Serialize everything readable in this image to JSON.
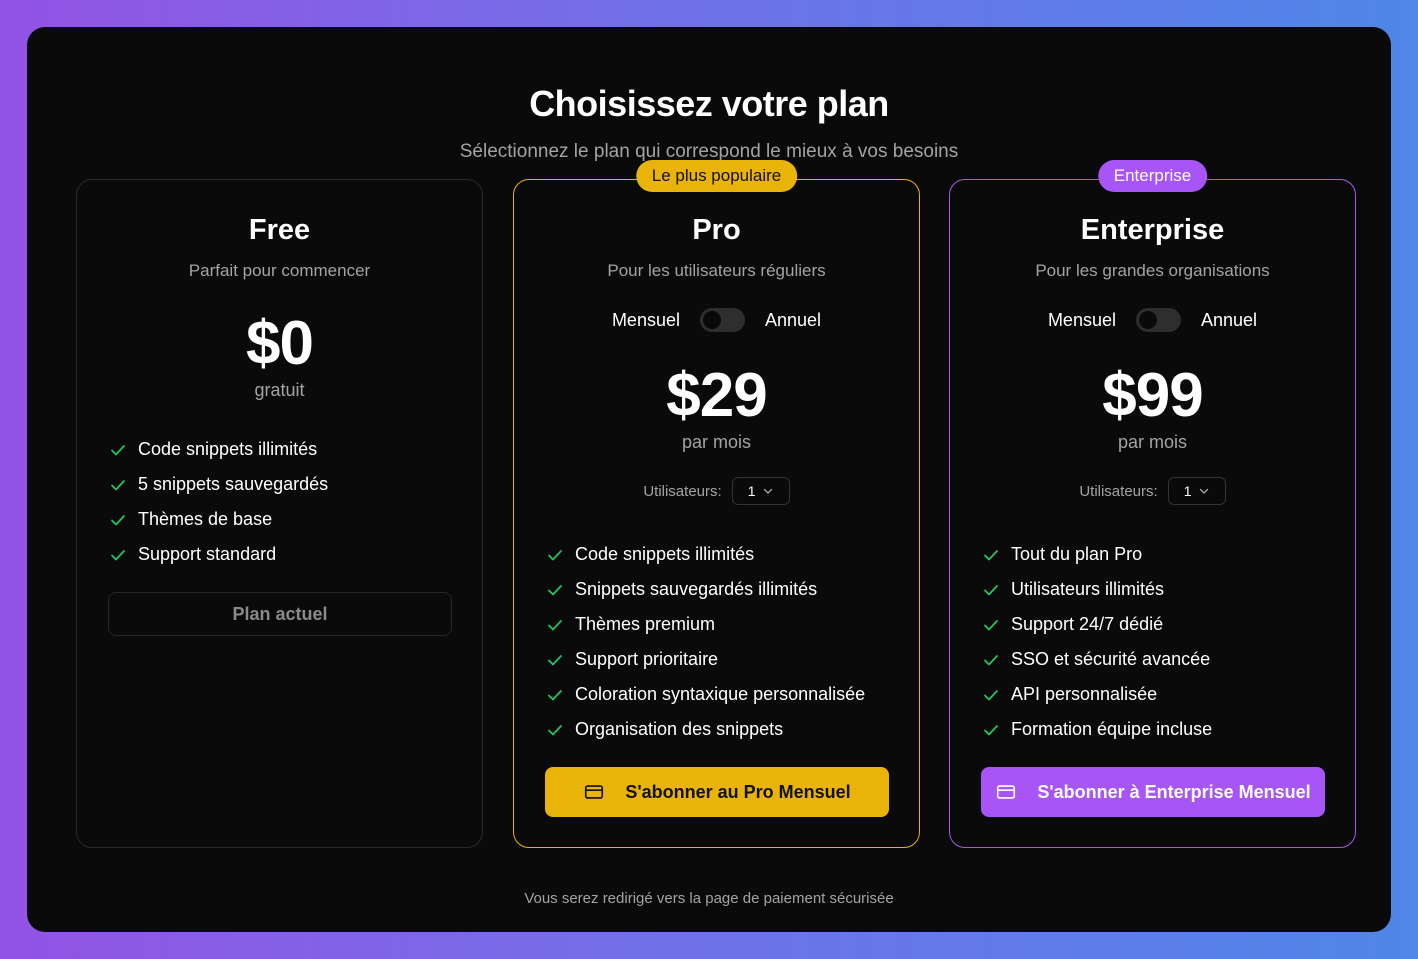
{
  "header": {
    "title": "Choisissez votre plan",
    "subtitle": "Sélectionnez le plan qui correspond le mieux à vos besoins"
  },
  "colors": {
    "accent_pro": "#eab308",
    "accent_enterprise": "#a855f7",
    "check": "#22c55e",
    "panel_bg": "#0a0a0a"
  },
  "plans": {
    "free": {
      "name": "Free",
      "description": "Parfait pour commencer",
      "price": "$0",
      "price_unit": "gratuit",
      "features": [
        "Code snippets illimités",
        "5 snippets sauvegardés",
        "Thèmes de base",
        "Support standard"
      ],
      "button_label": "Plan actuel"
    },
    "pro": {
      "badge": "Le plus populaire",
      "name": "Pro",
      "description": "Pour les utilisateurs réguliers",
      "toggle": {
        "left_label": "Mensuel",
        "right_label": "Annuel",
        "annual_selected": false
      },
      "price": "$29",
      "price_unit": "par mois",
      "users_label": "Utilisateurs:",
      "users_value": "1",
      "features": [
        "Code snippets illimités",
        "Snippets sauvegardés illimités",
        "Thèmes premium",
        "Support prioritaire",
        "Coloration syntaxique personnalisée",
        "Organisation des snippets"
      ],
      "button_label": "S'abonner au Pro Mensuel",
      "button_icon": "credit-card-icon"
    },
    "enterprise": {
      "badge": "Enterprise",
      "name": "Enterprise",
      "description": "Pour les grandes organisations",
      "toggle": {
        "left_label": "Mensuel",
        "right_label": "Annuel",
        "annual_selected": false
      },
      "price": "$99",
      "price_unit": "par mois",
      "users_label": "Utilisateurs:",
      "users_value": "1",
      "features": [
        "Tout du plan Pro",
        "Utilisateurs illimités",
        "Support 24/7 dédié",
        "SSO et sécurité avancée",
        "API personnalisée",
        "Formation équipe incluse"
      ],
      "button_label": "S'abonner à Enterprise Mensuel",
      "button_icon": "credit-card-icon"
    }
  },
  "footer": {
    "note": "Vous serez redirigé vers la page de paiement sécurisée"
  }
}
